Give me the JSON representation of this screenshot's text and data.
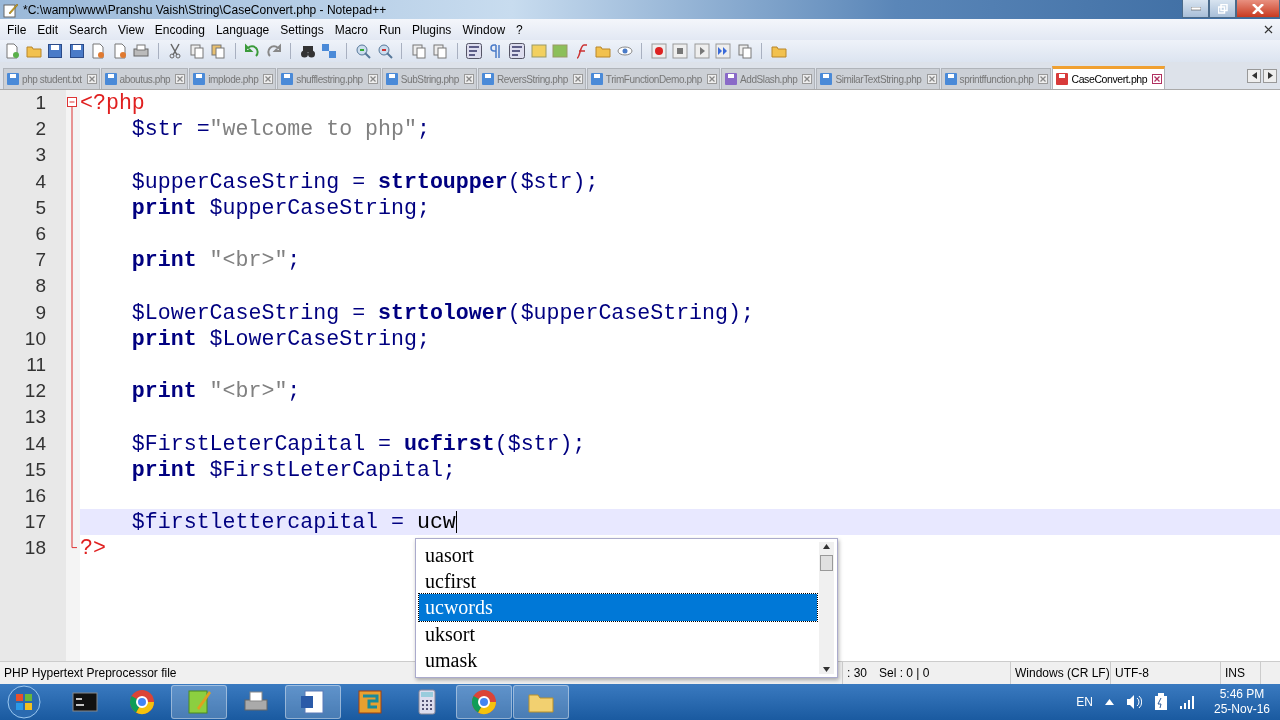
{
  "window": {
    "title": "*C:\\wamp\\www\\Pranshu Vaish\\String\\CaseConvert.php - Notepad++"
  },
  "menu": [
    "File",
    "Edit",
    "Search",
    "View",
    "Encoding",
    "Language",
    "Settings",
    "Macro",
    "Run",
    "Plugins",
    "Window",
    "?"
  ],
  "tabs": [
    {
      "label": "php student.txt",
      "selected": false,
      "color": "#4a8ad8"
    },
    {
      "label": "aboutus.php",
      "selected": false,
      "color": "#4a8ad8"
    },
    {
      "label": "implode.php",
      "selected": false,
      "color": "#4a8ad8"
    },
    {
      "label": "shufflestring.php",
      "selected": false,
      "color": "#4a8ad8"
    },
    {
      "label": "SubString.php",
      "selected": false,
      "color": "#4a8ad8"
    },
    {
      "label": "ReversString.php",
      "selected": false,
      "color": "#4a8ad8"
    },
    {
      "label": "TrimFunctionDemo.php",
      "selected": false,
      "color": "#4a8ad8"
    },
    {
      "label": "AddSlash.php",
      "selected": false,
      "color": "#8a6ac8"
    },
    {
      "label": "SimilarTextString.php",
      "selected": false,
      "color": "#4a8ad8"
    },
    {
      "label": "sprintffunction.php",
      "selected": false,
      "color": "#4a8ad8"
    },
    {
      "label": "CaseConvert.php",
      "selected": true,
      "color": "#d83a3a"
    }
  ],
  "editor": {
    "lines": [
      {
        "number": "1",
        "current": false,
        "tokens": [
          {
            "kind": "tag",
            "text": "<?php"
          }
        ]
      },
      {
        "number": "2",
        "current": false,
        "tokens": [
          {
            "kind": "var",
            "text": "    $str"
          },
          {
            "kind": "op",
            "text": " ="
          },
          {
            "kind": "str",
            "text": "\"welcome to php\""
          },
          {
            "kind": "op",
            "text": ";"
          }
        ]
      },
      {
        "number": "3",
        "current": false
      },
      {
        "number": "4",
        "current": false,
        "tokens": [
          {
            "kind": "var",
            "text": "    $upperCaseString"
          },
          {
            "kind": "op",
            "text": " = "
          },
          {
            "kind": "fn",
            "text": "strtoupper"
          },
          {
            "kind": "op",
            "text": "("
          },
          {
            "kind": "var",
            "text": "$str"
          },
          {
            "kind": "op",
            "text": ");"
          }
        ]
      },
      {
        "number": "5",
        "current": false,
        "tokens": [
          {
            "kind": "kw",
            "text": "    print"
          },
          {
            "kind": "var",
            "text": " $upperCaseString"
          },
          {
            "kind": "op",
            "text": ";"
          }
        ]
      },
      {
        "number": "6",
        "current": false
      },
      {
        "number": "7",
        "current": false,
        "tokens": [
          {
            "kind": "kw",
            "text": "    print"
          },
          {
            "kind": "str",
            "text": " \"<br>\""
          },
          {
            "kind": "op",
            "text": ";"
          }
        ]
      },
      {
        "number": "8",
        "current": false
      },
      {
        "number": "9",
        "current": false,
        "tokens": [
          {
            "kind": "var",
            "text": "    $LowerCaseString"
          },
          {
            "kind": "op",
            "text": " = "
          },
          {
            "kind": "fn",
            "text": "strtolower"
          },
          {
            "kind": "op",
            "text": "("
          },
          {
            "kind": "var",
            "text": "$upperCaseString"
          },
          {
            "kind": "op",
            "text": ");"
          }
        ]
      },
      {
        "number": "10",
        "current": false,
        "tokens": [
          {
            "kind": "kw",
            "text": "    print"
          },
          {
            "kind": "var",
            "text": " $LowerCaseString"
          },
          {
            "kind": "op",
            "text": ";"
          }
        ]
      },
      {
        "number": "11",
        "current": false
      },
      {
        "number": "12",
        "current": false,
        "tokens": [
          {
            "kind": "kw",
            "text": "    print"
          },
          {
            "kind": "str",
            "text": " \"<br>\""
          },
          {
            "kind": "op",
            "text": ";"
          }
        ]
      },
      {
        "number": "13",
        "current": false
      },
      {
        "number": "14",
        "current": false,
        "tokens": [
          {
            "kind": "var",
            "text": "    $FirstLeterCapital"
          },
          {
            "kind": "op",
            "text": " = "
          },
          {
            "kind": "fn",
            "text": "ucfirst"
          },
          {
            "kind": "op",
            "text": "("
          },
          {
            "kind": "var",
            "text": "$str"
          },
          {
            "kind": "op",
            "text": ");"
          }
        ]
      },
      {
        "number": "15",
        "current": false,
        "tokens": [
          {
            "kind": "kw",
            "text": "    print"
          },
          {
            "kind": "var",
            "text": " $FirstLeterCapital"
          },
          {
            "kind": "op",
            "text": ";"
          }
        ]
      },
      {
        "number": "16",
        "current": false
      },
      {
        "number": "17",
        "current": true,
        "tokens": [
          {
            "kind": "var",
            "text": "    $firstlettercapital"
          },
          {
            "kind": "op",
            "text": " = "
          },
          {
            "kind": "plain",
            "text": "ucw"
          }
        ]
      },
      {
        "number": "18",
        "current": false,
        "tokens": [
          {
            "kind": "tag",
            "text": "?>"
          }
        ]
      }
    ]
  },
  "autocomplete": [
    {
      "label": "uasort",
      "selected": false
    },
    {
      "label": "ucfirst",
      "selected": false
    },
    {
      "label": "ucwords",
      "selected": true
    },
    {
      "label": "uksort",
      "selected": false
    },
    {
      "label": "umask",
      "selected": false
    }
  ],
  "status_bar": {
    "file_type": "PHP Hypertext Preprocessor file",
    "position": ": 30",
    "selection": "Sel : 0 | 0",
    "line_endings": "Windows (CR LF)",
    "encoding": "UTF-8",
    "mode": "INS"
  },
  "taskbar": {
    "language": "EN",
    "time": "5:46 PM",
    "date": "25-Nov-16"
  }
}
